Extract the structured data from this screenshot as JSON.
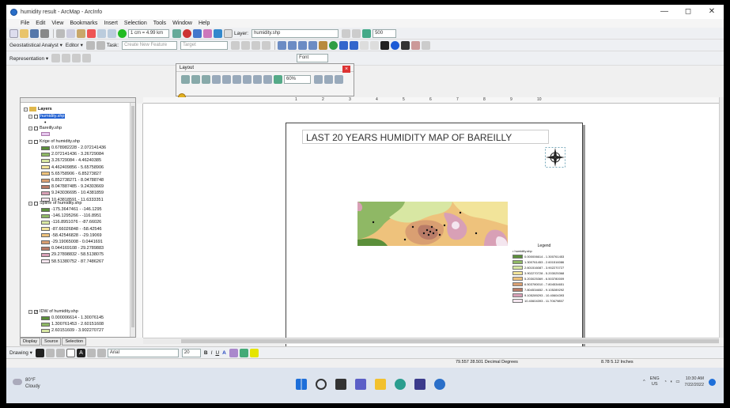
{
  "window": {
    "title": "humidity result - ArcMap - ArcInfo",
    "controls": [
      "—",
      "◻",
      "✕"
    ]
  },
  "menu": [
    "File",
    "Edit",
    "View",
    "Bookmarks",
    "Insert",
    "Selection",
    "Tools",
    "Window",
    "Help"
  ],
  "toolbar1": {
    "scale": "1 cm = 4.99 km",
    "layer_label": "Layer:",
    "layer_value": "humidity.shp",
    "zoom_value": "500"
  },
  "toolbar2": {
    "geostat_label": "Geostatistical Analyst ▾",
    "editor_label": "Editor ▾",
    "task_placeholder": "Create New Feature",
    "target_placeholder": "Target"
  },
  "toolbar3": {
    "representation_label": "Representation ▾",
    "font_value": "Font"
  },
  "layout_toolbar": {
    "title": "Layout",
    "zoom_value": "60%"
  },
  "toc": {
    "root": "Layers",
    "layers": [
      {
        "name": "humidity.shp",
        "selected": true
      },
      {
        "name": "Bareilly.shp"
      },
      {
        "name": "Krige of humidity.shp",
        "classes": [
          {
            "label": "0.678982228 - 2.072141436",
            "color": "#5b8f3a"
          },
          {
            "label": "2.072141436 - 3.26729084",
            "color": "#8fb865"
          },
          {
            "label": "3.26729084 - 4.46240385",
            "color": "#d8e7a3"
          },
          {
            "label": "4.462409856 - 5.65758906",
            "color": "#f2e49a"
          },
          {
            "label": "5.65758906 - 6.85273827",
            "color": "#eec27c"
          },
          {
            "label": "6.852738271 - 8.04788748",
            "color": "#d99f72"
          },
          {
            "label": "8.047887485 - 9.24303669",
            "color": "#b87b67"
          },
          {
            "label": "9.243036695 - 10.4381859",
            "color": "#d8a0b6"
          },
          {
            "label": "10.43818591 - 11.6333351",
            "color": "#f4e6ef"
          }
        ]
      },
      {
        "name": "Spline of humidity.shp",
        "classes": [
          {
            "label": "-175.3647461 - -146.1295",
            "color": "#5b8f3a"
          },
          {
            "label": "-146.1295266 - -116.8951",
            "color": "#8fb865"
          },
          {
            "label": "-116.8951076 - -87.66026",
            "color": "#d8e7a3"
          },
          {
            "label": "-87.66026848 - -58.42546",
            "color": "#f2e49a"
          },
          {
            "label": "-58.42546828 - -29.19069",
            "color": "#eec27c"
          },
          {
            "label": "-29.19065008 - 0.0441691",
            "color": "#d99f72"
          },
          {
            "label": "0.044169108 - 29.2789883",
            "color": "#b87b67"
          },
          {
            "label": "29.27898832 - 58.5138075",
            "color": "#d8a0b6"
          },
          {
            "label": "58.51380752 - 87.7486267",
            "color": "#f4e6ef"
          }
        ]
      },
      {
        "name": "IDW of humidity.shp",
        "classes": [
          {
            "label": "0.000006614 - 1.30076145",
            "color": "#5b8f3a"
          },
          {
            "label": "1.300761453 - 2.60151608",
            "color": "#8fb865"
          },
          {
            "label": "2.60151609 - 3.902270727",
            "color": "#d8e7a3"
          }
        ]
      }
    ],
    "tabs": [
      "Display",
      "Source",
      "Selection"
    ]
  },
  "ruler_labels": [
    "1",
    "2",
    "3",
    "4",
    "5",
    "6",
    "7",
    "8",
    "9",
    "10"
  ],
  "layout": {
    "title": "LAST 20 YEARS HUMIDITY MAP OF BAREILLY",
    "legend": {
      "title": "Legend",
      "point_layer": "• humidity.shp",
      "classes": [
        {
          "label": "0.000006614 - 1.300761453",
          "color": "#5b8f3a"
        },
        {
          "label": "1.300761453 - 2.601516086",
          "color": "#8fb865"
        },
        {
          "label": "2.601516087 - 3.902270727",
          "color": "#d8e7a3"
        },
        {
          "label": "3.902270728 - 5.203025368",
          "color": "#f2e49a"
        },
        {
          "label": "5.203025369 - 6.503780009",
          "color": "#eec27c"
        },
        {
          "label": "6.503780010 - 7.804534651",
          "color": "#d99f72"
        },
        {
          "label": "7.804534652 - 9.105289292",
          "color": "#b87b67"
        },
        {
          "label": "9.105289293 - 10.40604393",
          "color": "#d8a0b6"
        },
        {
          "label": "10.40604393 - 11.70679857",
          "color": "#f4e6ef"
        }
      ]
    }
  },
  "drawing_bar": {
    "drawing_label": "Drawing ▾",
    "font": "Arial",
    "size": "20",
    "bold": "B",
    "italic": "I",
    "underline": "U",
    "font_color": "A"
  },
  "status": {
    "coords": "79.557  28.501 Decimal Degrees",
    "page_size": "8.78  5.12 Inches"
  },
  "taskbar": {
    "weather_temp": "80°F",
    "weather_desc": "Cloudy",
    "tray_lang": "ENG",
    "tray_region": "US",
    "time": "10:30 AM",
    "date": "7/22/2022"
  }
}
